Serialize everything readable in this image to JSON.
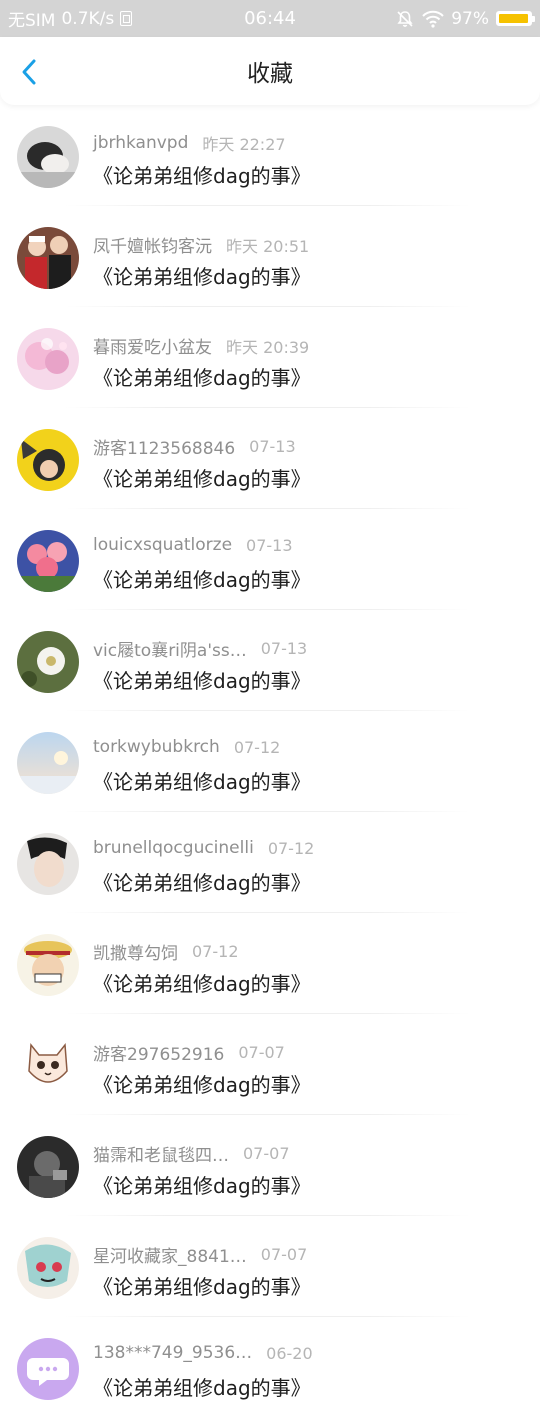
{
  "status_bar": {
    "carrier": "无SIM",
    "speed": "0.7K/s",
    "time": "06:44",
    "battery": "97%"
  },
  "navbar": {
    "back_icon": "chevron-left-icon",
    "title": "收藏"
  },
  "favorites": [
    {
      "user": "jbrhkanvpd",
      "time": "昨天 22:27",
      "title": "《论弟弟组修dag的事》",
      "avatar": "photo"
    },
    {
      "user": "凤千嬗帐钧客沅",
      "time": "昨天 20:51",
      "title": "《论弟弟组修dag的事》",
      "avatar": "photo"
    },
    {
      "user": "暮雨爱吃小盆友",
      "time": "昨天 20:39",
      "title": "《论弟弟组修dag的事》",
      "avatar": "photo"
    },
    {
      "user": "游客1123568846",
      "time": "07-13",
      "title": "《论弟弟组修dag的事》",
      "avatar": "photo"
    },
    {
      "user": "louicxsquatlorze",
      "time": "07-13",
      "title": "《论弟弟组修dag的事》",
      "avatar": "photo"
    },
    {
      "user": "vic屦to襄ri阴a'ss…",
      "time": "07-13",
      "title": "《论弟弟组修dag的事》",
      "avatar": "photo"
    },
    {
      "user": "torkwybubkrch",
      "time": "07-12",
      "title": "《论弟弟组修dag的事》",
      "avatar": "photo"
    },
    {
      "user": "brunellqocgucinelli",
      "time": "07-12",
      "title": "《论弟弟组修dag的事》",
      "avatar": "photo"
    },
    {
      "user": "凯撒尊勾饲",
      "time": "07-12",
      "title": "《论弟弟组修dag的事》",
      "avatar": "photo"
    },
    {
      "user": "游客297652916",
      "time": "07-07",
      "title": "《论弟弟组修dag的事》",
      "avatar": "photo"
    },
    {
      "user": "猫霈和老鼠毯四…",
      "time": "07-07",
      "title": "《论弟弟组修dag的事》",
      "avatar": "photo"
    },
    {
      "user": "星河收藏家_8841…",
      "time": "07-07",
      "title": "《论弟弟组修dag的事》",
      "avatar": "photo"
    },
    {
      "user": "138***749_9536…",
      "time": "06-20",
      "title": "《论弟弟组修dag的事》",
      "avatar": "chat-bubble-icon"
    }
  ],
  "colors": {
    "status_bar_bg": "#d4d4d4",
    "accent_blue": "#1aa0e6",
    "battery_fill": "#f6c200",
    "default_avatar_bg": "#c9a8ef"
  }
}
